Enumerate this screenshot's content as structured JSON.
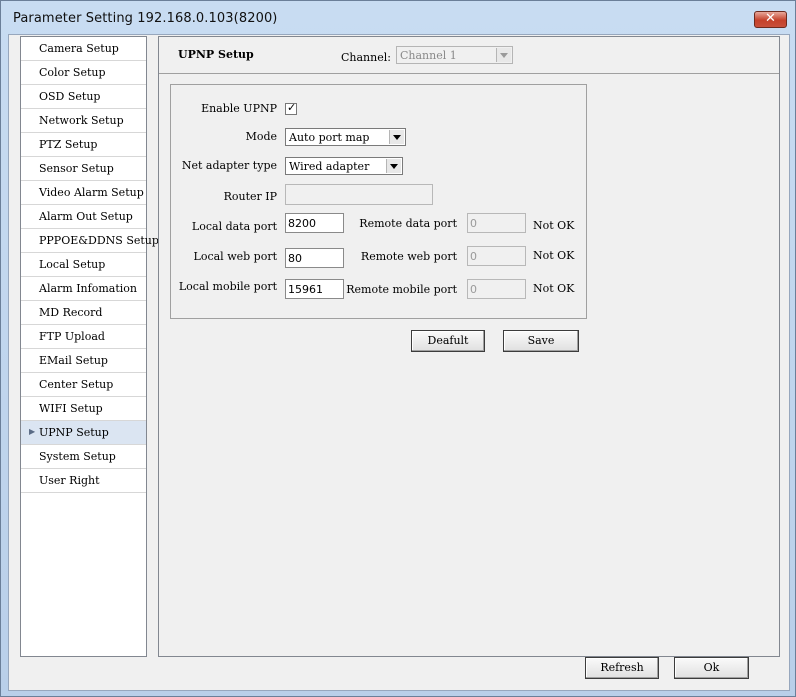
{
  "window": {
    "title": "Parameter Setting 192.168.0.103(8200)",
    "close_glyph": "✕"
  },
  "sidebar": {
    "items": [
      {
        "label": "Camera Setup"
      },
      {
        "label": "Color Setup"
      },
      {
        "label": "OSD Setup"
      },
      {
        "label": "Network Setup"
      },
      {
        "label": "PTZ Setup"
      },
      {
        "label": "Sensor Setup"
      },
      {
        "label": "Video Alarm Setup"
      },
      {
        "label": "Alarm Out Setup"
      },
      {
        "label": "PPPOE&DDNS Setup"
      },
      {
        "label": "Local Setup"
      },
      {
        "label": "Alarm Infomation"
      },
      {
        "label": "MD Record"
      },
      {
        "label": "FTP Upload"
      },
      {
        "label": "EMail Setup"
      },
      {
        "label": "Center Setup"
      },
      {
        "label": "WIFI Setup"
      },
      {
        "label": "UPNP Setup",
        "selected": true
      },
      {
        "label": "System Setup"
      },
      {
        "label": "User Right"
      }
    ],
    "selected_arrow": "▶"
  },
  "main": {
    "title": "UPNP Setup",
    "channel_label": "Channel:",
    "channel_value": "Channel 1",
    "form": {
      "enable_upnp_label": "Enable UPNP",
      "enable_upnp_checked": true,
      "check_glyph": "✓",
      "mode_label": "Mode",
      "mode_value": "Auto port map",
      "net_adapter_label": "Net adapter type",
      "net_adapter_value": "Wired adapter",
      "router_ip_label": "Router IP",
      "router_ip_value": "",
      "local_data_port_label": "Local data port",
      "local_data_port_value": "8200",
      "remote_data_port_label": "Remote data port",
      "remote_data_port_value": "0",
      "remote_data_port_status": "Not OK",
      "local_web_port_label": "Local web port",
      "local_web_port_value": "80",
      "remote_web_port_label": "Remote web port",
      "remote_web_port_value": "0",
      "remote_web_port_status": "Not OK",
      "local_mobile_port_label": "Local mobile port",
      "local_mobile_port_value": "15961",
      "remote_mobile_port_label": "Remote mobile port",
      "remote_mobile_port_value": "0",
      "remote_mobile_port_status": "Not OK"
    },
    "default_button": "Deafult",
    "save_button": "Save"
  },
  "footer": {
    "refresh_button": "Refresh",
    "ok_button": "Ok"
  }
}
